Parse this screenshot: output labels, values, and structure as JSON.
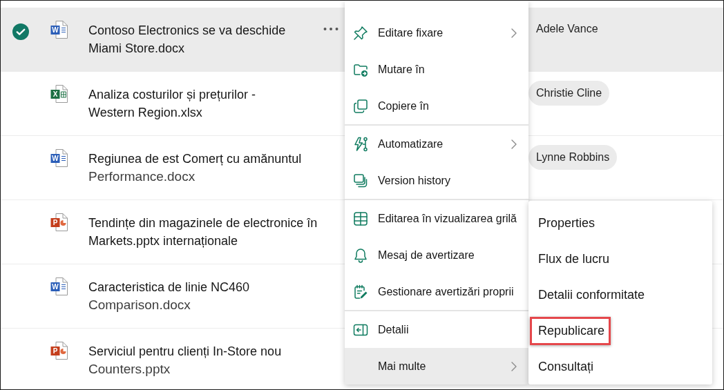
{
  "files": [
    {
      "kind": "word",
      "icon_letter": "W",
      "selected": true,
      "lines": [
        {
          "text": "Contoso Electronics se va deschide",
          "kind": "primary"
        },
        {
          "text": "Miami Store.docx",
          "kind": "primary"
        }
      ],
      "person": "Adele Vance"
    },
    {
      "kind": "excel",
      "icon_letter": "X",
      "selected": false,
      "lines": [
        {
          "text": "Analiza costurilor și prețurilor -",
          "kind": "primary"
        },
        {
          "text": "Western Region.xlsx",
          "kind": "primary"
        }
      ],
      "person": "Christie Cline"
    },
    {
      "kind": "word",
      "icon_letter": "W",
      "selected": false,
      "lines": [
        {
          "text": "Regiunea de est Comerț cu amănuntul",
          "kind": "primary"
        },
        {
          "text": "Performance.docx",
          "kind": "secondary"
        }
      ],
      "person": "Lynne Robbins"
    },
    {
      "kind": "powerpoint",
      "icon_letter": "P",
      "selected": false,
      "lines": [
        {
          "text": "Tendințe din magazinele de electronice în",
          "kind": "primary"
        },
        {
          "text": "Markets.pptx internaționale",
          "kind": "primary"
        }
      ]
    },
    {
      "kind": "word",
      "icon_letter": "W",
      "selected": false,
      "lines": [
        {
          "text": "Caracteristica de linie NC460",
          "kind": "primary"
        },
        {
          "text": "Comparison.docx",
          "kind": "secondary"
        }
      ]
    },
    {
      "kind": "powerpoint",
      "icon_letter": "P",
      "selected": false,
      "lines": [
        {
          "text": "Serviciul pentru clienți In-Store nou",
          "kind": "primary"
        },
        {
          "text": "Counters.pptx",
          "kind": "secondary"
        }
      ]
    }
  ],
  "menu": {
    "sections": [
      {
        "items": [
          {
            "label": "Editare fixare",
            "kind": "pin",
            "submenu": true,
            "selected": false
          },
          {
            "label": "Mutare în",
            "kind": "move",
            "submenu": false,
            "selected": false
          },
          {
            "label": "Copiere în",
            "kind": "copy",
            "submenu": false,
            "selected": false
          }
        ]
      },
      {
        "items": [
          {
            "label": "Automatizare",
            "kind": "automate",
            "submenu": true,
            "selected": false
          },
          {
            "label": "Version history",
            "kind": "history",
            "submenu": false,
            "selected": false
          }
        ]
      },
      {
        "items": [
          {
            "label": "Editarea în vizualizarea grilă",
            "kind": "grid",
            "submenu": false,
            "selected": false
          },
          {
            "label": "Mesaj de avertizare",
            "kind": "alert",
            "submenu": false,
            "selected": false
          },
          {
            "label": "Gestionare avertizări proprii",
            "kind": "manage",
            "submenu": false,
            "selected": false
          }
        ]
      },
      {
        "items": [
          {
            "label": "Detalii",
            "kind": "details",
            "submenu": false,
            "selected": false
          },
          {
            "label": "Mai multe",
            "kind": "more",
            "submenu": true,
            "selected": true
          }
        ]
      }
    ]
  },
  "submenu": {
    "items": [
      {
        "label": "Properties",
        "highlighted": false
      },
      {
        "label": "Flux de lucru",
        "highlighted": false
      },
      {
        "label": "Detalii conformitate",
        "highlighted": false
      },
      {
        "label": "Republicare",
        "highlighted": true
      },
      {
        "label": "Consultați",
        "highlighted": false
      }
    ]
  }
}
